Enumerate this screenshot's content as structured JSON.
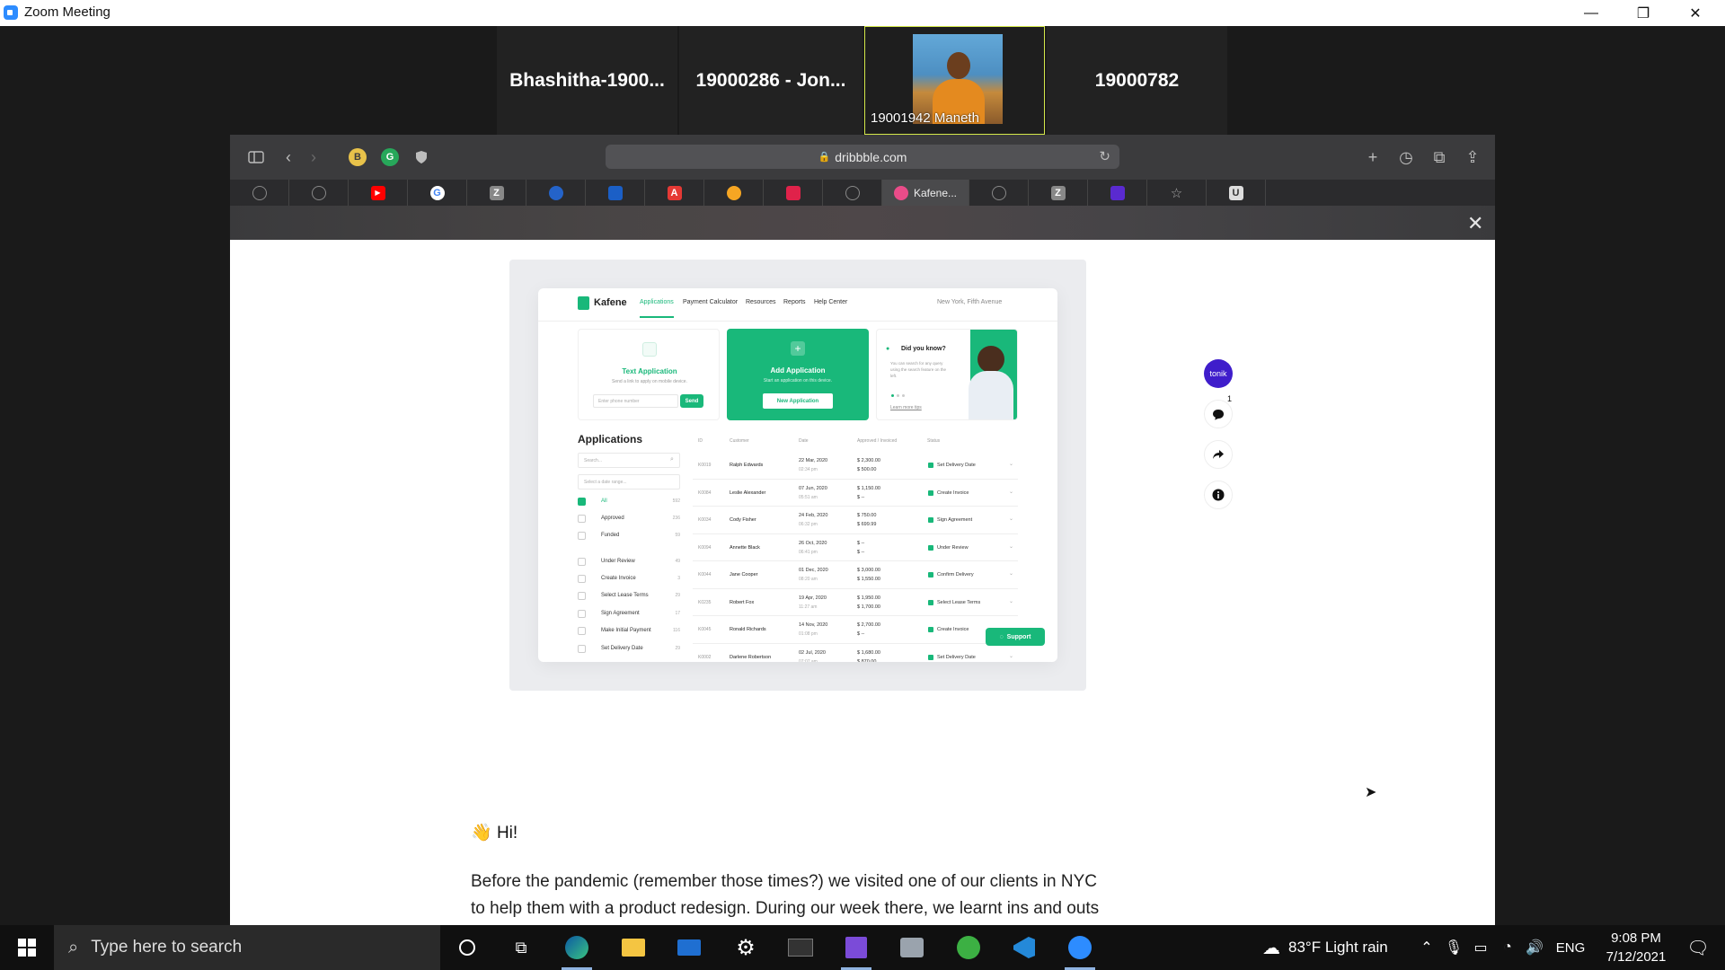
{
  "window": {
    "title": "Zoom Meeting",
    "minimize": "—",
    "restore": "❐",
    "close": "✕"
  },
  "participants": [
    {
      "name": "Bhashitha-1900..."
    },
    {
      "name": "19000286 - Jon..."
    },
    {
      "name": "19001942 Maneth",
      "muted": true
    },
    {
      "name": "19000782"
    }
  ],
  "browser": {
    "url": "dribbble.com",
    "active_tab_label": "Kafene...",
    "colors": {
      "accent": "#19b87a",
      "tonik": "#3f1dcb"
    }
  },
  "kafene": {
    "brand": "Kafene",
    "nav": [
      "Applications",
      "Payment Calculator",
      "Resources",
      "Reports",
      "Help Center"
    ],
    "location": "New York, Fifth Avenue",
    "text_app": {
      "title": "Text Application",
      "subtitle": "Send a link to apply on mobile device.",
      "placeholder": "Enter phone number",
      "button": "Send"
    },
    "add_app": {
      "title": "Add Application",
      "subtitle": "Start an application on this device.",
      "button": "New Application"
    },
    "tip": {
      "title": "Did you know?",
      "body": "You can search for any query using the search feature on the left.",
      "link": "Learn more tips"
    },
    "list_title": "Applications",
    "search_placeholder": "Search...",
    "date_placeholder": "Select a date range...",
    "filters": [
      {
        "label": "All",
        "count": "592"
      },
      {
        "label": "Approved",
        "count": "236"
      },
      {
        "label": "Funded",
        "count": "59"
      },
      {
        "label": "Under Review",
        "count": "49"
      },
      {
        "label": "Create Invoice",
        "count": "3"
      },
      {
        "label": "Select Lease Terms",
        "count": "29"
      },
      {
        "label": "Sign Agreement",
        "count": "17"
      },
      {
        "label": "Make Initial Payment",
        "count": "116"
      },
      {
        "label": "Set Delivery Date",
        "count": "29"
      }
    ],
    "columns": [
      "ID",
      "Customer",
      "Date",
      "Approved / Invoiced",
      "Status"
    ],
    "rows": [
      {
        "id": "K0019",
        "customer": "Ralph Edwards",
        "date": "22 Mar, 2020",
        "time": "02:34 pm",
        "approved": "$ 2,300.00",
        "invoiced": "$ 500.00",
        "status": "Set Delivery Date"
      },
      {
        "id": "K0084",
        "customer": "Leslie Alexander",
        "date": "07 Jun, 2020",
        "time": "05:51 am",
        "approved": "$ 1,150.00",
        "invoiced": "$ --",
        "status": "Create Invoice"
      },
      {
        "id": "K0034",
        "customer": "Cody Fisher",
        "date": "24 Feb, 2020",
        "time": "06:32 pm",
        "approved": "$ 750.00",
        "invoiced": "$ 699.99",
        "status": "Sign Agreement"
      },
      {
        "id": "K0094",
        "customer": "Annette Black",
        "date": "26 Oct, 2020",
        "time": "06:41 pm",
        "approved": "$ --",
        "invoiced": "$ --",
        "status": "Under Review"
      },
      {
        "id": "K0044",
        "customer": "Jane Cooper",
        "date": "01 Dec, 2020",
        "time": "08:20 am",
        "approved": "$ 3,000.00",
        "invoiced": "$ 1,550.00",
        "status": "Confirm Delivery"
      },
      {
        "id": "K0235",
        "customer": "Robert Fox",
        "date": "19 Apr, 2020",
        "time": "11:27 am",
        "approved": "$ 1,950.00",
        "invoiced": "$ 1,700.00",
        "status": "Select Lease Terms"
      },
      {
        "id": "K0045",
        "customer": "Ronald Richards",
        "date": "14 Nov, 2020",
        "time": "01:08 pm",
        "approved": "$ 2,700.00",
        "invoiced": "$ --",
        "status": "Create Invoice"
      },
      {
        "id": "K0002",
        "customer": "Darlene Robertson",
        "date": "02 Jul, 2020",
        "time": "07:07 am",
        "approved": "$ 1,680.00",
        "invoiced": "$ 870.00",
        "status": "Set Delivery Date"
      }
    ],
    "support": "Support"
  },
  "sidebar_actions": {
    "tonik": "tonik",
    "comment_count": "1"
  },
  "article": {
    "greeting": "Hi!",
    "wave": "👋",
    "paragraph": "Before the pandemic (remember those times?) we visited one of our clients in NYC to help them with a product redesign. During our week there, we learnt ins and outs"
  },
  "taskbar": {
    "search_placeholder": "Type here to search",
    "weather": "83°F  Light rain",
    "language": "ENG",
    "time": "9:08 PM",
    "date": "7/12/2021"
  }
}
